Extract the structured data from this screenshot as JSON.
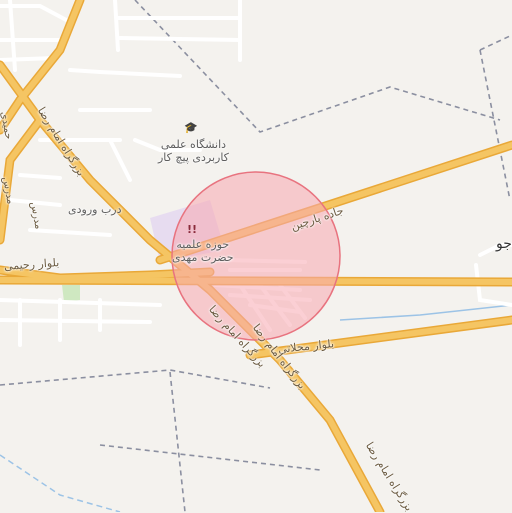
{
  "map": {
    "colors": {
      "background": "#f4f2ee",
      "major_road": "#f5c563",
      "major_road_casing": "#e9a838",
      "minor_road": "#ffffff",
      "minor_road_casing": "#d8d4cc",
      "boundary": "#8b8fa0",
      "water": "#9cc3e6",
      "park": "#cfe8c1",
      "campus": "#e7dcf0",
      "circle_fill": "#f7a8b0",
      "circle_stroke": "#e8737f"
    },
    "labels": {
      "university": "دانشگاه علمی\nکاربردی پیچ کار",
      "seminary": "حوزه علمیه\nحضرت مهدی",
      "entrance": "درب ورودی",
      "parchin_road": "جاده پارچین",
      "rahimi_blvd": "بلوار رحیمی",
      "mahallati_blvd": "بلوار محلاتی",
      "imam_reza_1": "بزرگراه امام رضا",
      "imam_reza_2": "بزرگراه امام رضا",
      "imam_reza_3": "بزرگراه امام رضا",
      "imam_reza_4": "بزرگراه امام رضا",
      "school": "مدرس",
      "edge_label": "جو",
      "small_1": "حمیدی",
      "small_2": "مدرس"
    },
    "icons": {
      "university": "graduation-cap",
      "seminary": "religious-school"
    }
  }
}
